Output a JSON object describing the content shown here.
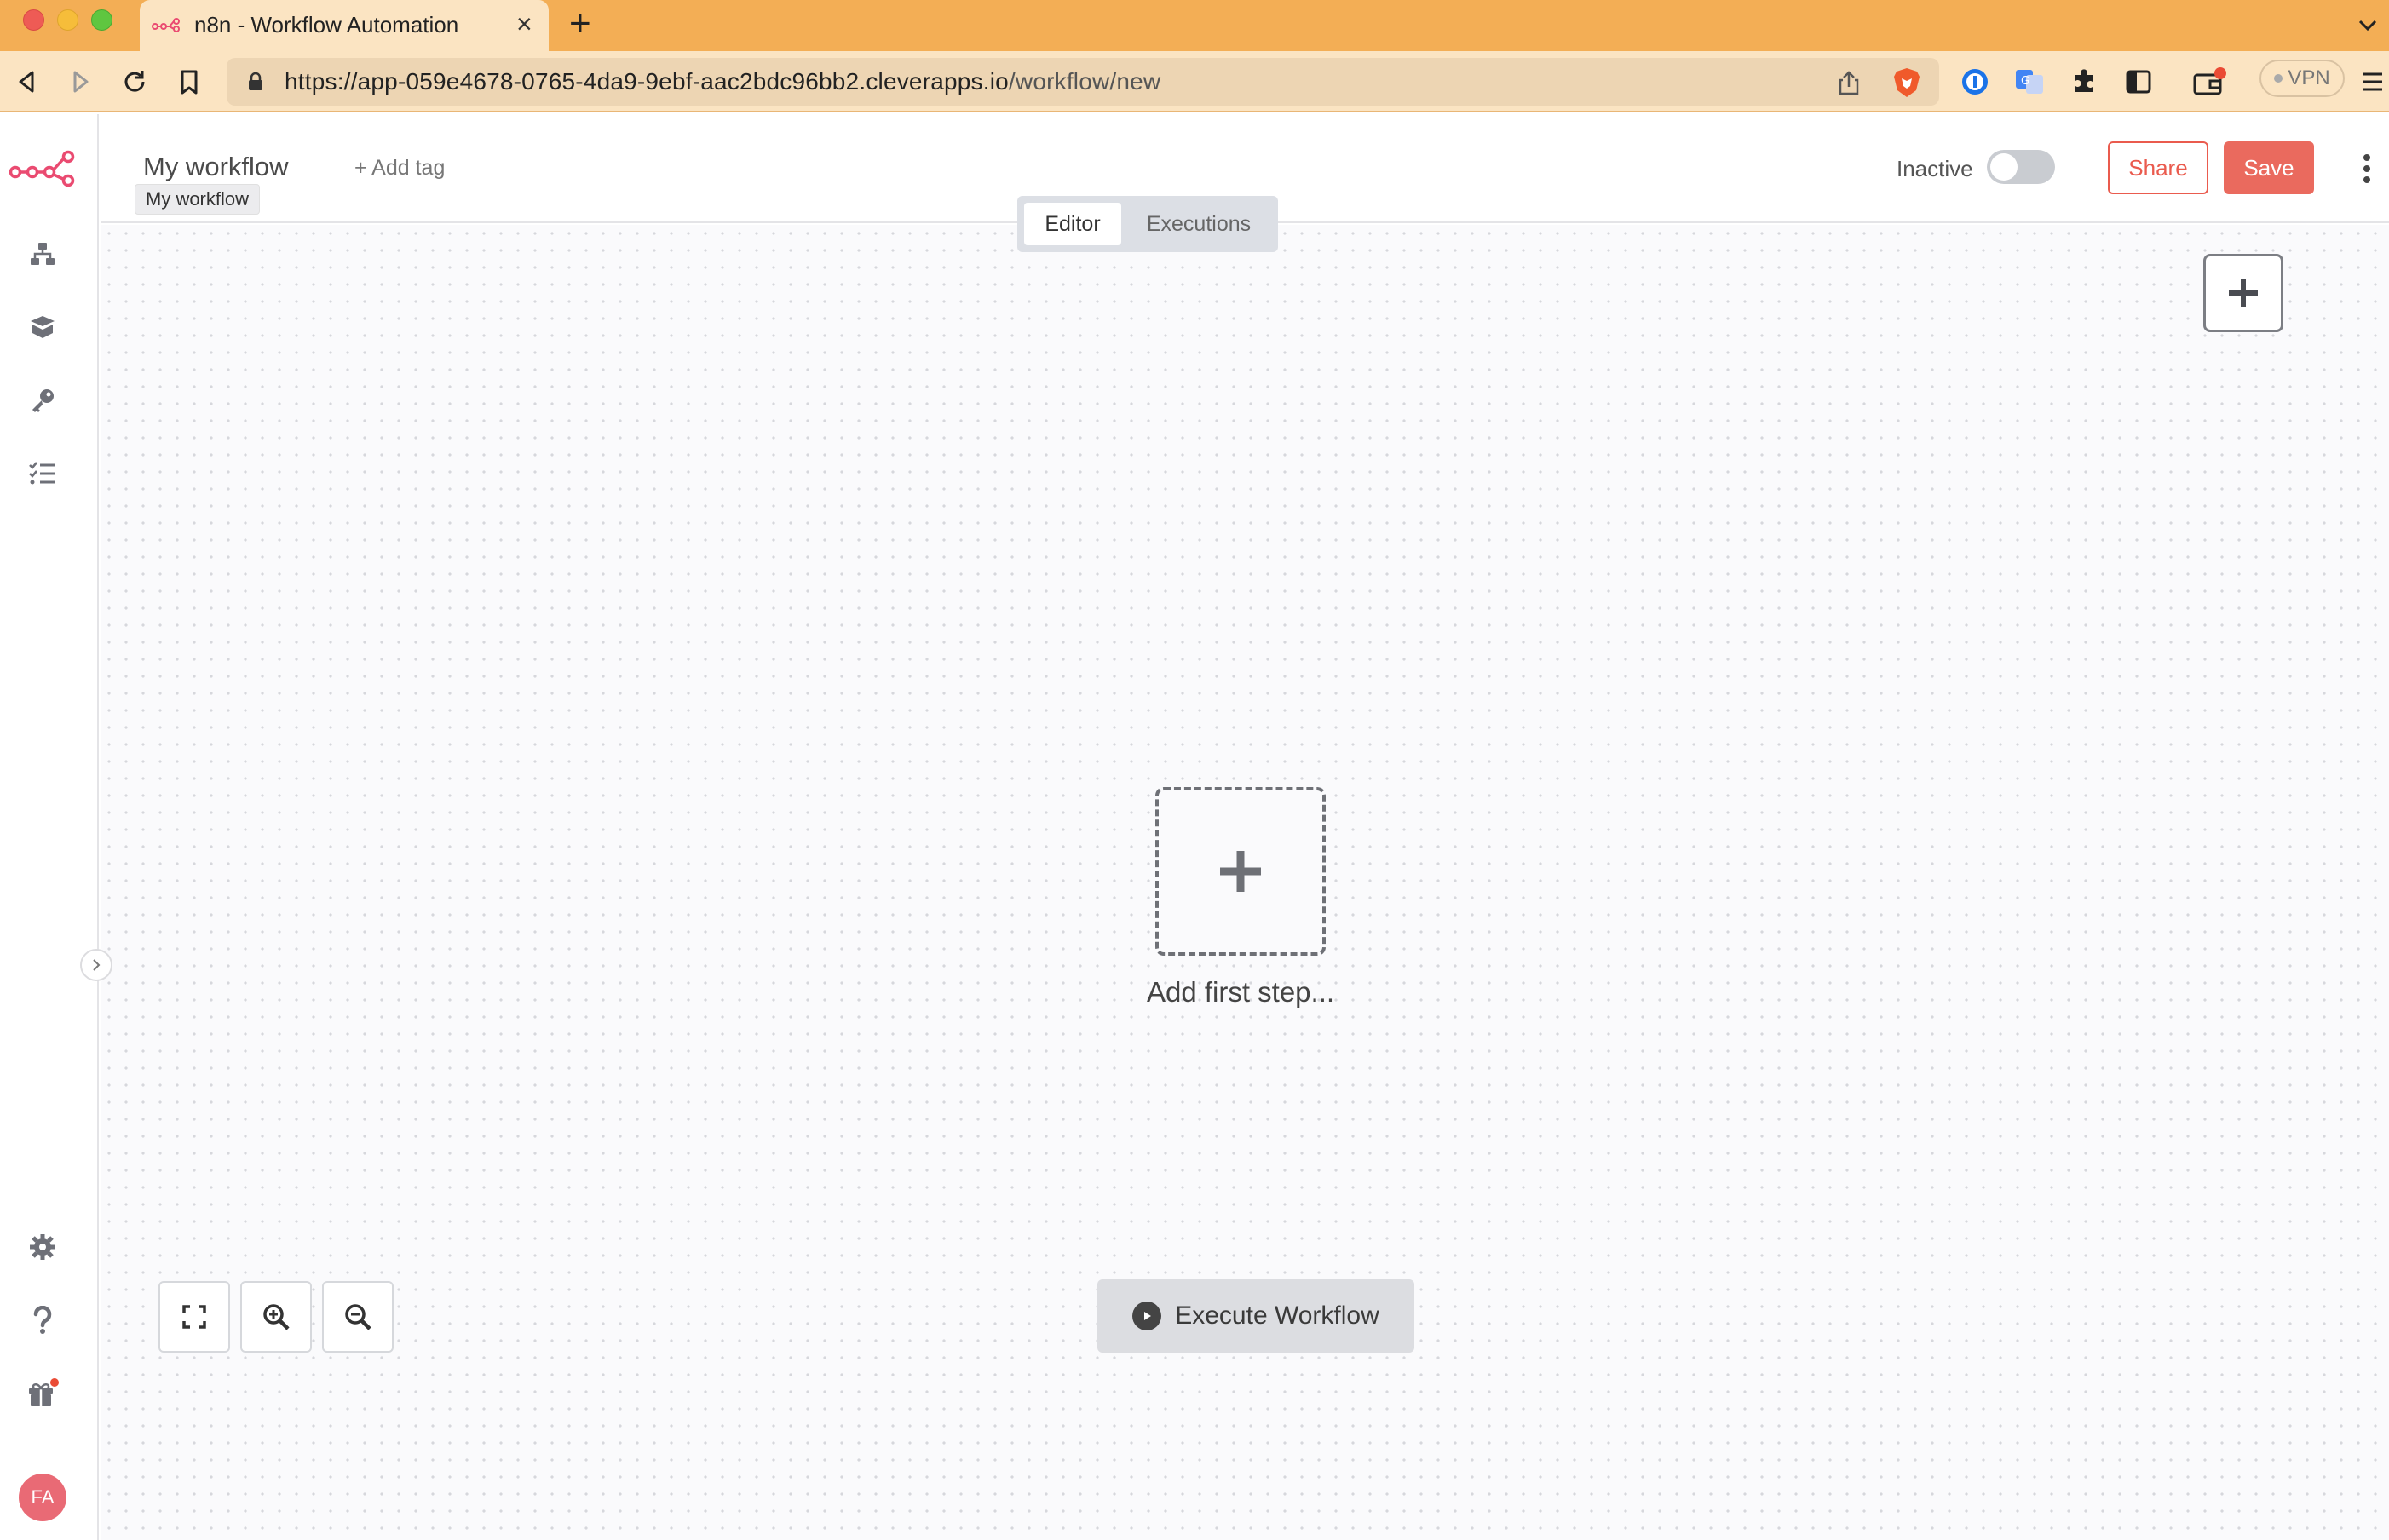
{
  "browser": {
    "tab_title": "n8n - Workflow Automation",
    "url_host": "https://app-059e4678-0765-4da9-9ebf-aac2bdc96bb2.cleverapps.io",
    "url_path": "/workflow/new",
    "vpn_label": "VPN"
  },
  "header": {
    "workflow_name": "My workflow",
    "tooltip": "My workflow",
    "add_tag": "+ Add tag",
    "status_label": "Inactive",
    "share_label": "Share",
    "save_label": "Save"
  },
  "modes": {
    "editor": "Editor",
    "executions": "Executions"
  },
  "canvas": {
    "first_step_label": "Add first step...",
    "execute_label": "Execute Workflow"
  },
  "user": {
    "initials": "FA"
  },
  "colors": {
    "brand": "#ea4b71",
    "primary": "#ea6a5e",
    "tabbar": "#f3ae55"
  }
}
